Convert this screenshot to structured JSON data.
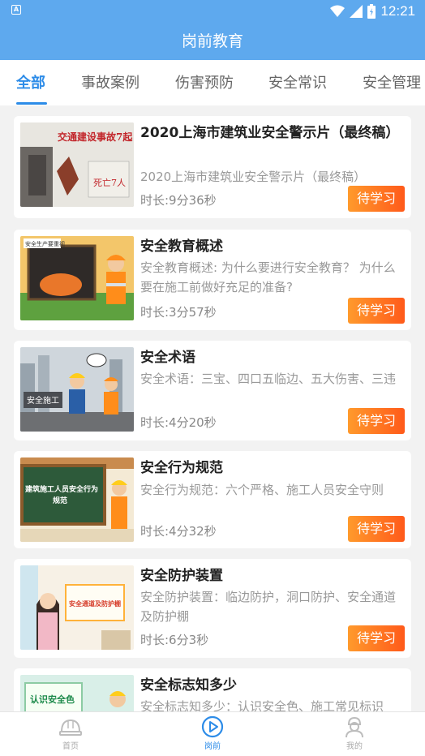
{
  "status_bar": {
    "time": "12:21",
    "app_badge": "A"
  },
  "header": {
    "title": "岗前教育"
  },
  "tabs": [
    {
      "label": "全部",
      "active": true
    },
    {
      "label": "事故案例",
      "active": false
    },
    {
      "label": "伤害预防",
      "active": false
    },
    {
      "label": "安全常识",
      "active": false
    },
    {
      "label": "安全管理",
      "active": false
    }
  ],
  "courses": [
    {
      "title": "2020上海市建筑业安全警示片（最终稿）",
      "description": "2020上海市建筑业安全警示片（最终稿）",
      "duration": "时长:9分36秒",
      "action": "待学习",
      "thumb_text": "交通建设事故7起",
      "thumb_text2": "死亡7人"
    },
    {
      "title": "安全教育概述",
      "description": "安全教育概述: 为什么要进行安全教育？ 为什么要在施工前做好充足的准备?",
      "duration": "时长:3分57秒",
      "action": "待学习",
      "thumb_text": "安全生产要重视"
    },
    {
      "title": "安全术语",
      "description": "安全术语：三宝、四口五临边、五大伤害、三违",
      "duration": "时长:4分20秒",
      "action": "待学习",
      "thumb_text": "安全施工"
    },
    {
      "title": "安全行为规范",
      "description": "安全行为规范：六个严格、施工人员安全守则",
      "duration": "时长:4分32秒",
      "action": "待学习",
      "thumb_text": "建筑施工人员安全行为规范"
    },
    {
      "title": "安全防护装置",
      "description": "安全防护装置：临边防护，洞口防护、安全通道及防护棚",
      "duration": "时长:6分3秒",
      "action": "待学习",
      "thumb_text": "安全通道及防护棚"
    },
    {
      "title": "安全标志知多少",
      "description": "安全标志知多少：认识安全色、施工常见标识",
      "duration": "",
      "action": "",
      "thumb_text": "认识安全色"
    }
  ],
  "bottom_nav": [
    {
      "label": "首页",
      "icon": "helmet-icon",
      "active": false
    },
    {
      "label": "岗前",
      "icon": "play-circle-icon",
      "active": true
    },
    {
      "label": "我的",
      "icon": "worker-icon",
      "active": false
    }
  ],
  "colors": {
    "header": "#5ea9ee",
    "accent": "#2d8ce8",
    "button": "#ff7a22"
  }
}
